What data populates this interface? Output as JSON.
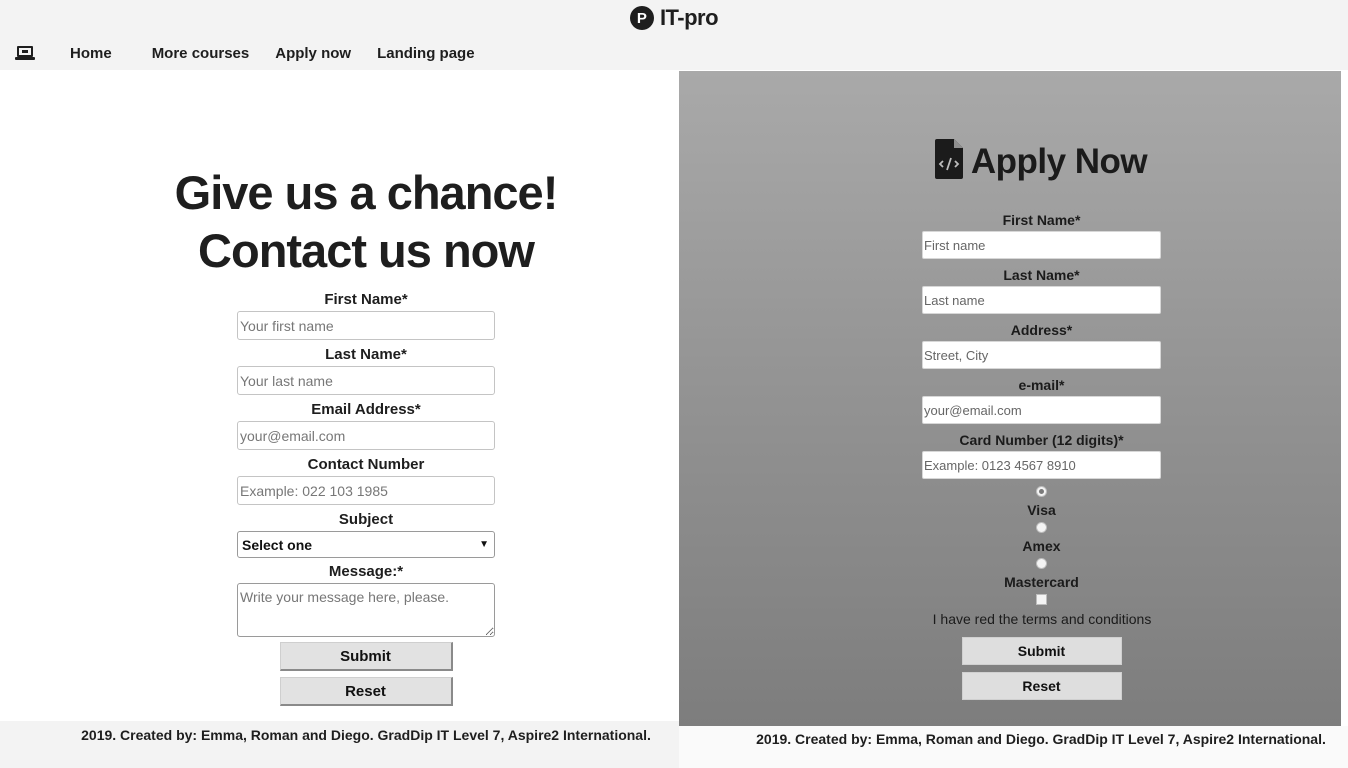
{
  "header": {
    "brand_logo_letter": "P",
    "brand_name": "IT-pro",
    "nav_icon": "laptop-icon",
    "nav": [
      "Home",
      "More courses",
      "Apply now",
      "Landing page"
    ]
  },
  "contact": {
    "heading_line1": "Give us a chance!",
    "heading_line2": "Contact us now",
    "first_name_label": "First Name*",
    "first_name_placeholder": "Your first name",
    "last_name_label": "Last Name*",
    "last_name_placeholder": "Your last name",
    "email_label": "Email Address*",
    "email_placeholder": "your@email.com",
    "phone_label": "Contact Number",
    "phone_placeholder": "Example: 022 103 1985",
    "subject_label": "Subject",
    "subject_selected": "Select one",
    "message_label": "Message:*",
    "message_placeholder": "Write your message here, please.",
    "submit_label": "Submit",
    "reset_label": "Reset"
  },
  "apply": {
    "title_icon": "file-code-icon",
    "title": "Apply Now",
    "first_name_label": "First Name*",
    "first_name_placeholder": "First name",
    "last_name_label": "Last Name*",
    "last_name_placeholder": "Last name",
    "address_label": "Address*",
    "address_placeholder": "Street, City",
    "email_label": "e-mail*",
    "email_placeholder": "your@email.com",
    "card_label": "Card Number (12 digits)*",
    "card_placeholder": "Example: 0123 4567 8910",
    "card_types": [
      "Visa",
      "Amex",
      "Mastercard"
    ],
    "selected_card_index": 0,
    "terms_label": "I have red the terms and conditions",
    "terms_checked": false,
    "submit_label": "Submit",
    "reset_label": "Reset"
  },
  "footer": {
    "left_text": "2019. Created by: Emma, Roman and Diego. GradDip IT Level 7, Aspire2 International.",
    "right_text": "2019. Created by: Emma, Roman and Diego. GradDip IT Level 7, Aspire2 International."
  },
  "colors": {
    "header_bg": "#f3f3f3",
    "panel_gradient_top": "#a9a9a9",
    "panel_gradient_bottom": "#7d7d7d",
    "text": "#1e1e1e",
    "button_bg": "#e2e2e2"
  }
}
